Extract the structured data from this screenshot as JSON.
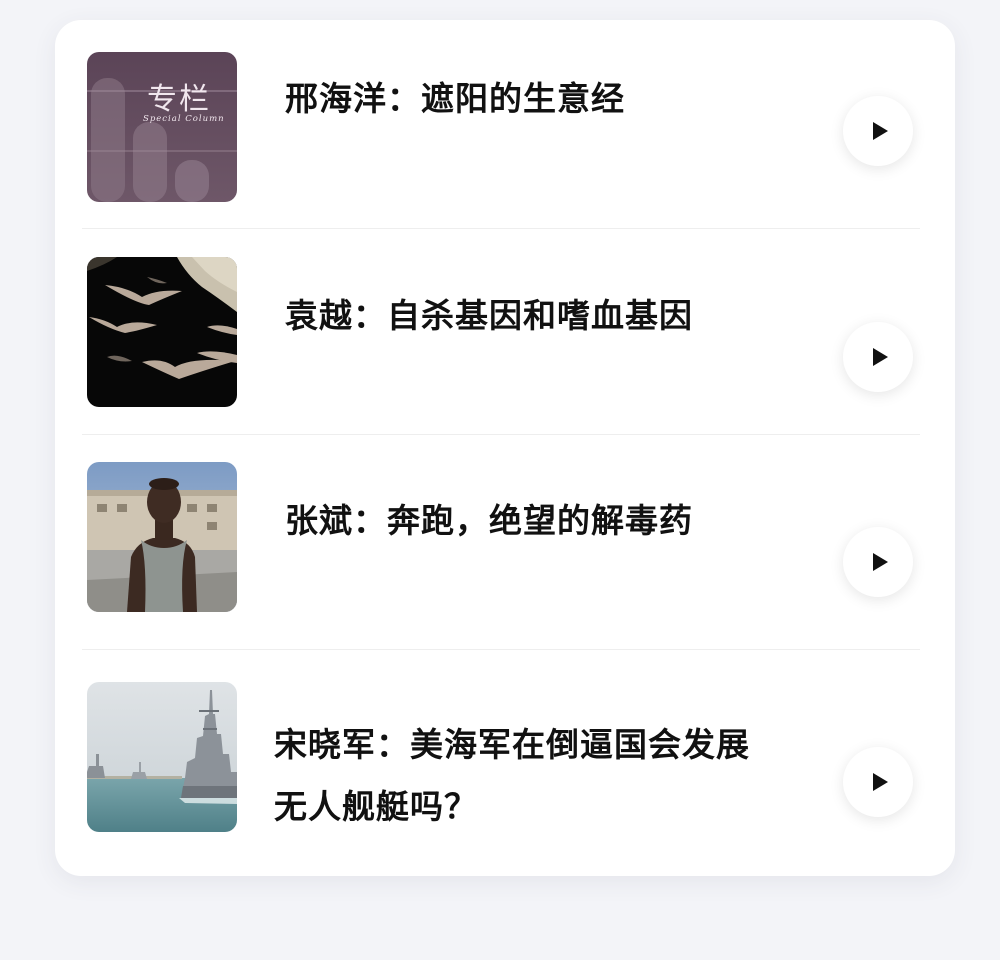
{
  "items": [
    {
      "title": "邢海洋：遮阳的生意经",
      "thumb": {
        "kind": "column-cover",
        "label": "专栏",
        "sublabel": "Special Column",
        "accent": "#5a4556"
      },
      "play_icon": "play-icon"
    },
    {
      "title": "袁越：自杀基因和嗜血基因",
      "thumb": {
        "kind": "photo-bats",
        "accent": "#0b0b0b"
      },
      "play_icon": "play-icon"
    },
    {
      "title": "张斌：奔跑，绝望的解毒药",
      "thumb": {
        "kind": "photo-runner",
        "accent": "#8aa6c6"
      },
      "play_icon": "play-icon"
    },
    {
      "title": "宋晓军：美海军在倒逼国会发展无人舰艇吗？",
      "thumb": {
        "kind": "photo-warship",
        "accent": "#5f8e96"
      },
      "play_icon": "play-icon"
    }
  ],
  "colors": {
    "page_bg": "#f3f4f8",
    "card_bg": "#ffffff",
    "title": "#111111",
    "play_glyph": "#111111"
  }
}
